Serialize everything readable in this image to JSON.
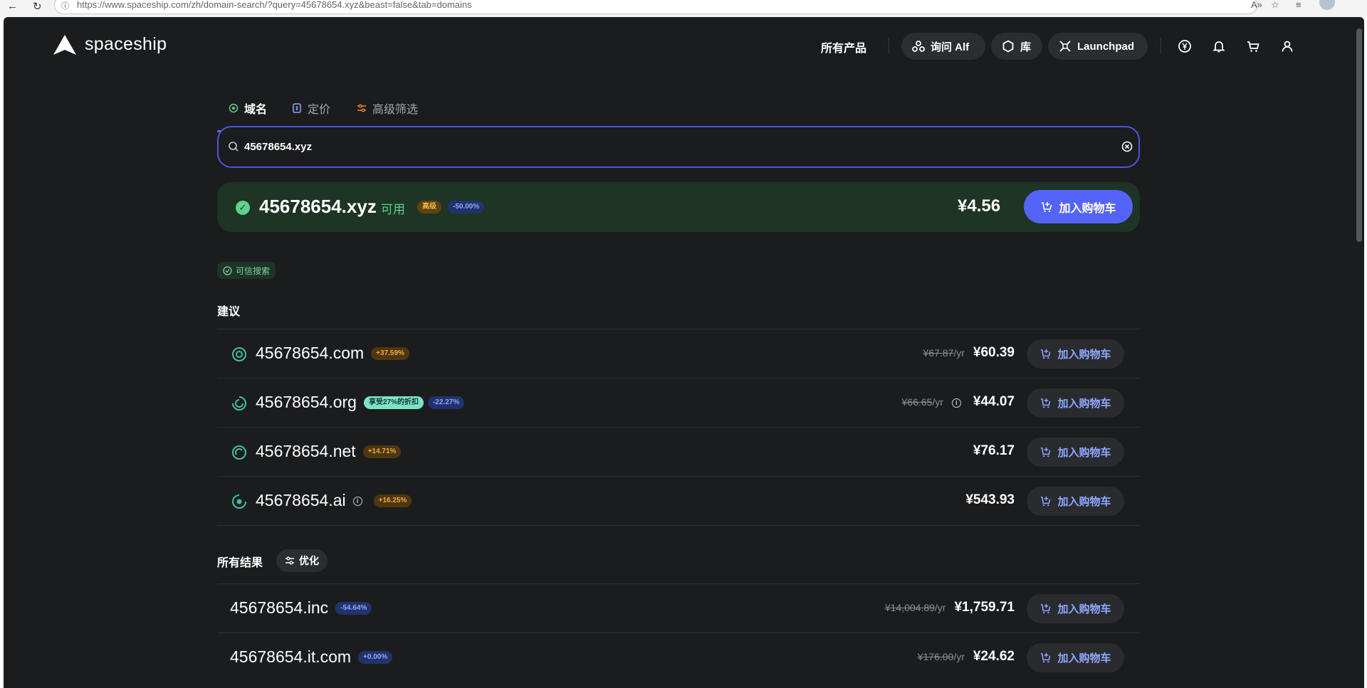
{
  "browser": {
    "url": "https://www.spaceship.com/zh/domain-search/?query=45678654.xyz&beast=false&tab=domains"
  },
  "header": {
    "logo_text": "spaceship",
    "all_products": "所有产品",
    "ask_alf": "询问 Alf",
    "library": "库",
    "launchpad": "Launchpad"
  },
  "tabs": [
    {
      "label": "域名",
      "active": true
    },
    {
      "label": "定价",
      "active": false
    },
    {
      "label": "高级筛选",
      "active": false
    }
  ],
  "search": {
    "value": "45678654.xyz"
  },
  "main_result": {
    "domain": "45678654.xyz",
    "status": "可用",
    "premium_badge": "高级",
    "discount_badge": "-50.00%",
    "price": "¥4.56",
    "cart_label": "加入购物车"
  },
  "trusted_label": "可信搜索",
  "suggestions": {
    "title": "建议",
    "items": [
      {
        "domain": "45678654.com",
        "badges": [
          {
            "text": "+37.59%",
            "style": "orange"
          }
        ],
        "info_before_badges": false,
        "old_price": "¥67.87",
        "per": "/yr",
        "price_info": false,
        "price": "¥60.39",
        "cart_label": "加入购物车"
      },
      {
        "domain": "45678654.org",
        "badges": [
          {
            "text": "享受27%的折扣",
            "style": "mint"
          },
          {
            "text": "-22.27%",
            "style": "blue"
          }
        ],
        "info_before_badges": false,
        "old_price": "¥66.65",
        "per": "/yr",
        "price_info": true,
        "price": "¥44.07",
        "cart_label": "加入购物车"
      },
      {
        "domain": "45678654.net",
        "badges": [
          {
            "text": "+14.71%",
            "style": "orange"
          }
        ],
        "info_before_badges": false,
        "old_price": "",
        "per": "",
        "price_info": false,
        "price": "¥76.17",
        "cart_label": "加入购物车"
      },
      {
        "domain": "45678654.ai",
        "badges": [
          {
            "text": "+16.25%",
            "style": "orange"
          }
        ],
        "info_before_badges": true,
        "old_price": "",
        "per": "",
        "price_info": false,
        "price": "¥543.93",
        "cart_label": "加入购物车"
      }
    ]
  },
  "all_results": {
    "title": "所有结果",
    "optimize_label": "优化",
    "items": [
      {
        "domain": "45678654.inc",
        "badges": [
          {
            "text": "-54.64%",
            "style": "blue"
          }
        ],
        "old_price": "¥14,004.89",
        "per": "/yr",
        "price": "¥1,759.71",
        "cart_label": "加入购物车"
      },
      {
        "domain": "45678654.it.com",
        "badges": [
          {
            "text": "+0.00%",
            "style": "blue"
          }
        ],
        "old_price": "¥176.00",
        "per": "/yr",
        "price": "¥24.62",
        "cart_label": "加入购物车"
      }
    ]
  },
  "colors": {
    "background": "#1b1c1e",
    "accent": "#5364f7",
    "available_green": "#5ed18a",
    "link_blue": "#8fa8ff"
  }
}
